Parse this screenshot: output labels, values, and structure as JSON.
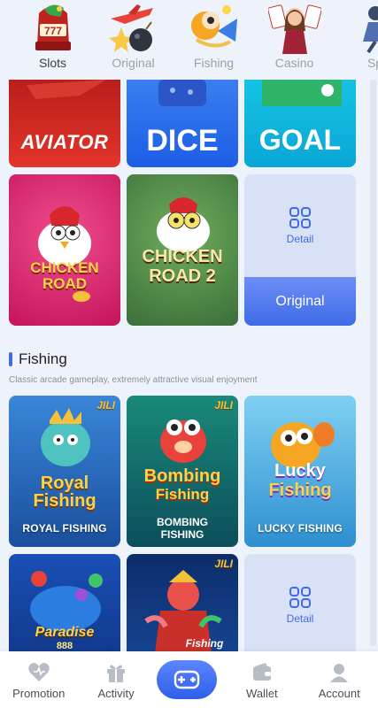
{
  "categories": [
    {
      "label": "Slots",
      "icon": "slot-machine-icon",
      "active": true
    },
    {
      "label": "Original",
      "icon": "airplane-bomb-icon"
    },
    {
      "label": "Fishing",
      "icon": "fish-icon"
    },
    {
      "label": "Casino",
      "icon": "dealer-icon"
    },
    {
      "label": "Sp",
      "icon": "sports-icon"
    }
  ],
  "original_games": {
    "row1": [
      {
        "title": "AVIATOR"
      },
      {
        "title": "DICE"
      },
      {
        "title": "GOAL"
      }
    ],
    "row2": [
      {
        "title_line1": "CHICKEN",
        "title_line2": "ROAD"
      },
      {
        "title_line1": "CHICKEN",
        "title_line2": "ROAD 2"
      }
    ],
    "detail_label": "Detail",
    "original_button": "Original"
  },
  "fishing": {
    "title": "Fishing",
    "subtitle": "Classic arcade gameplay, extremely attractive visual enjoyment",
    "games": [
      {
        "logo_line1": "Royal",
        "logo_line2": "Fishing",
        "name": "ROYAL FISHING",
        "badge": "JILI"
      },
      {
        "logo_line1": "Bombing",
        "logo_line2": "Fishing",
        "name_line1": "BOMBING",
        "name_line2": "FISHING",
        "badge": "JILI"
      },
      {
        "logo_line1": "Lucky",
        "logo_line2": "Fishing",
        "name": "LUCKY FISHING"
      }
    ],
    "row2": [
      {
        "logo": "Paradise",
        "sub": "888"
      },
      {
        "logo": "Fishing",
        "badge": "JILI"
      }
    ],
    "detail_label": "Detail"
  },
  "bottom_nav": {
    "promotion": "Promotion",
    "activity": "Activity",
    "wallet": "Wallet",
    "account": "Account"
  },
  "colors": {
    "accent": "#3f6be8",
    "background": "#eef2fb"
  }
}
